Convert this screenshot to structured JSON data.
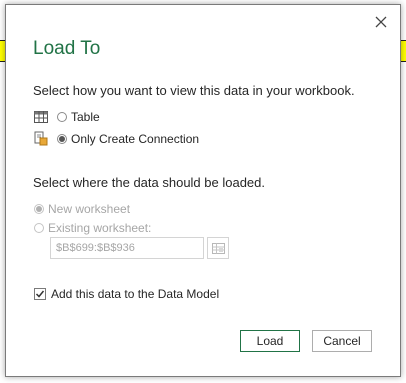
{
  "dialog": {
    "title": "Load To",
    "view_prompt": "Select how you want to view this data in your workbook.",
    "view_options": [
      {
        "label": "Table",
        "selected": false,
        "icon": "table-icon"
      },
      {
        "label": "Only Create Connection",
        "selected": true,
        "icon": "connection-icon"
      }
    ],
    "location_prompt": "Select where the data should be loaded.",
    "location_options": [
      {
        "label": "New worksheet",
        "selected": true,
        "enabled": false
      },
      {
        "label": "Existing worksheet:",
        "selected": false,
        "enabled": false
      }
    ],
    "range_value": "$B$699:$B$936",
    "data_model_label": "Add this data to the Data Model",
    "data_model_checked": true,
    "load_button": "Load",
    "cancel_button": "Cancel"
  },
  "colors": {
    "accent": "#217346",
    "disabled": "#a6a6a6"
  }
}
